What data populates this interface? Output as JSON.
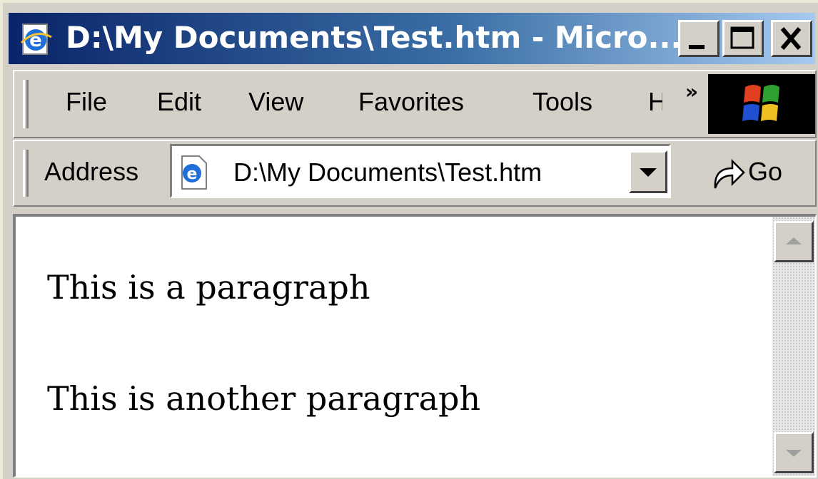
{
  "window": {
    "title": "D:\\My Documents\\Test.htm - Micro..."
  },
  "menu": {
    "items": [
      "File",
      "Edit",
      "View",
      "Favorites",
      "Tools",
      "H"
    ],
    "overflow_icon": "double-chevron-right-icon"
  },
  "address_bar": {
    "label": "Address",
    "value": "D:\\My Documents\\Test.htm",
    "go_label": "Go"
  },
  "page": {
    "paragraphs": [
      "This is a paragraph",
      "This is another paragraph"
    ]
  },
  "colors": {
    "titlebar_start": "#0a246a",
    "titlebar_end": "#a6caf0",
    "chrome": "#d4d0c8"
  }
}
